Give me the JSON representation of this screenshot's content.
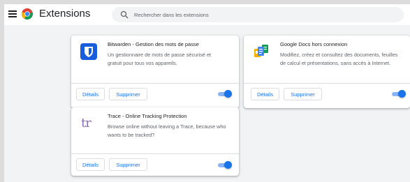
{
  "header": {
    "menu_icon": "hamburger-menu-icon",
    "logo_icon": "chrome-logo-icon",
    "title": "Extensions",
    "search": {
      "icon": "search-icon",
      "placeholder": "Rechercher dans les extensions",
      "value": ""
    }
  },
  "extensions": [
    {
      "name": "Bitwarden - Gestion des mots de passe",
      "description": "Un gestionnaire de mots de passe sécurisé et gratuit pour tous vos appareils.",
      "icon": "bitwarden-shield-icon",
      "details_label": "Détails",
      "remove_label": "Supprimer",
      "enabled": true
    },
    {
      "name": "Google Docs hors connexion",
      "description": "Modifiez, créez et consultez des documents, feuilles de calcul et présentations, sans accès à Internet.",
      "icon": "google-docs-icon",
      "details_label": "Détails",
      "remove_label": "Supprimer",
      "enabled": true
    },
    {
      "name": "Trace - Online Tracking Protection",
      "description": "Browse online without leaving a Trace, because who wants to be tracked?",
      "icon": "trace-logo-icon",
      "logo_text": "tr",
      "details_label": "Détails",
      "remove_label": "Supprimer",
      "enabled": true
    }
  ],
  "colors": {
    "accent": "#1a73e8",
    "toggle_track": "#8ab4f8",
    "bitwarden": "#175ddc",
    "trace": "#8e6ab8"
  }
}
